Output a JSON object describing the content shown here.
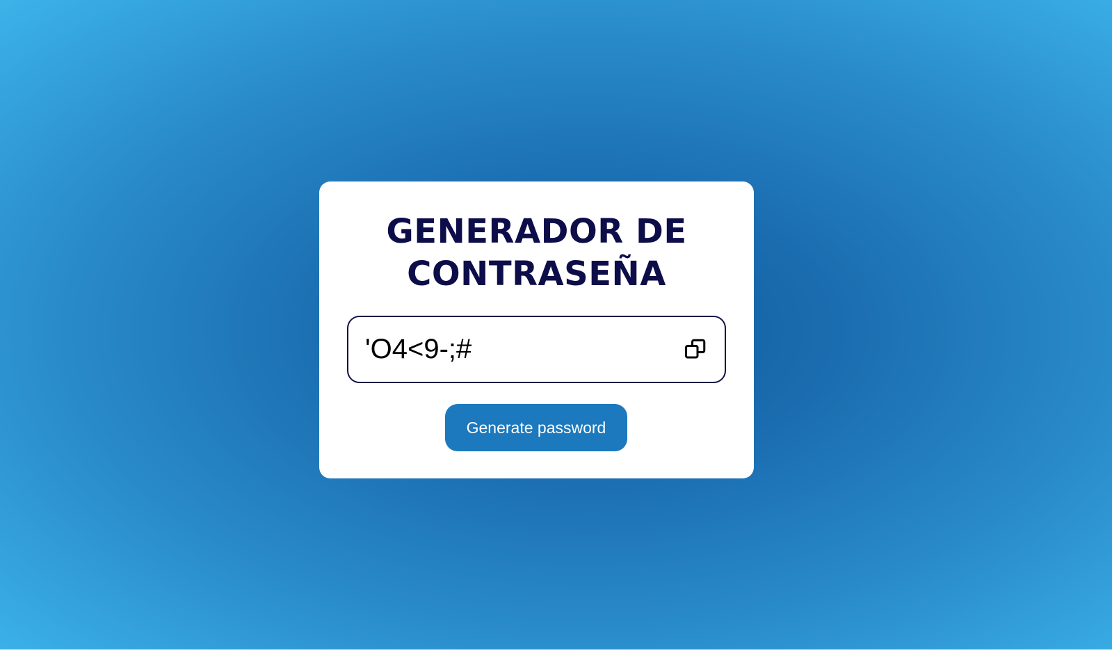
{
  "title": {
    "line1": "GENERADOR DE",
    "line2": "CONTRASEÑA"
  },
  "password": {
    "value": "'O4<9-;#"
  },
  "copy_button": {
    "icon": "copy-icon"
  },
  "generate_button": {
    "label": "Generate password"
  },
  "colors": {
    "background_center": "#0f5d9e",
    "background_edge": "#3cb3ea",
    "title": "#0d0d4a",
    "button": "#1c79bd",
    "card": "#ffffff"
  }
}
